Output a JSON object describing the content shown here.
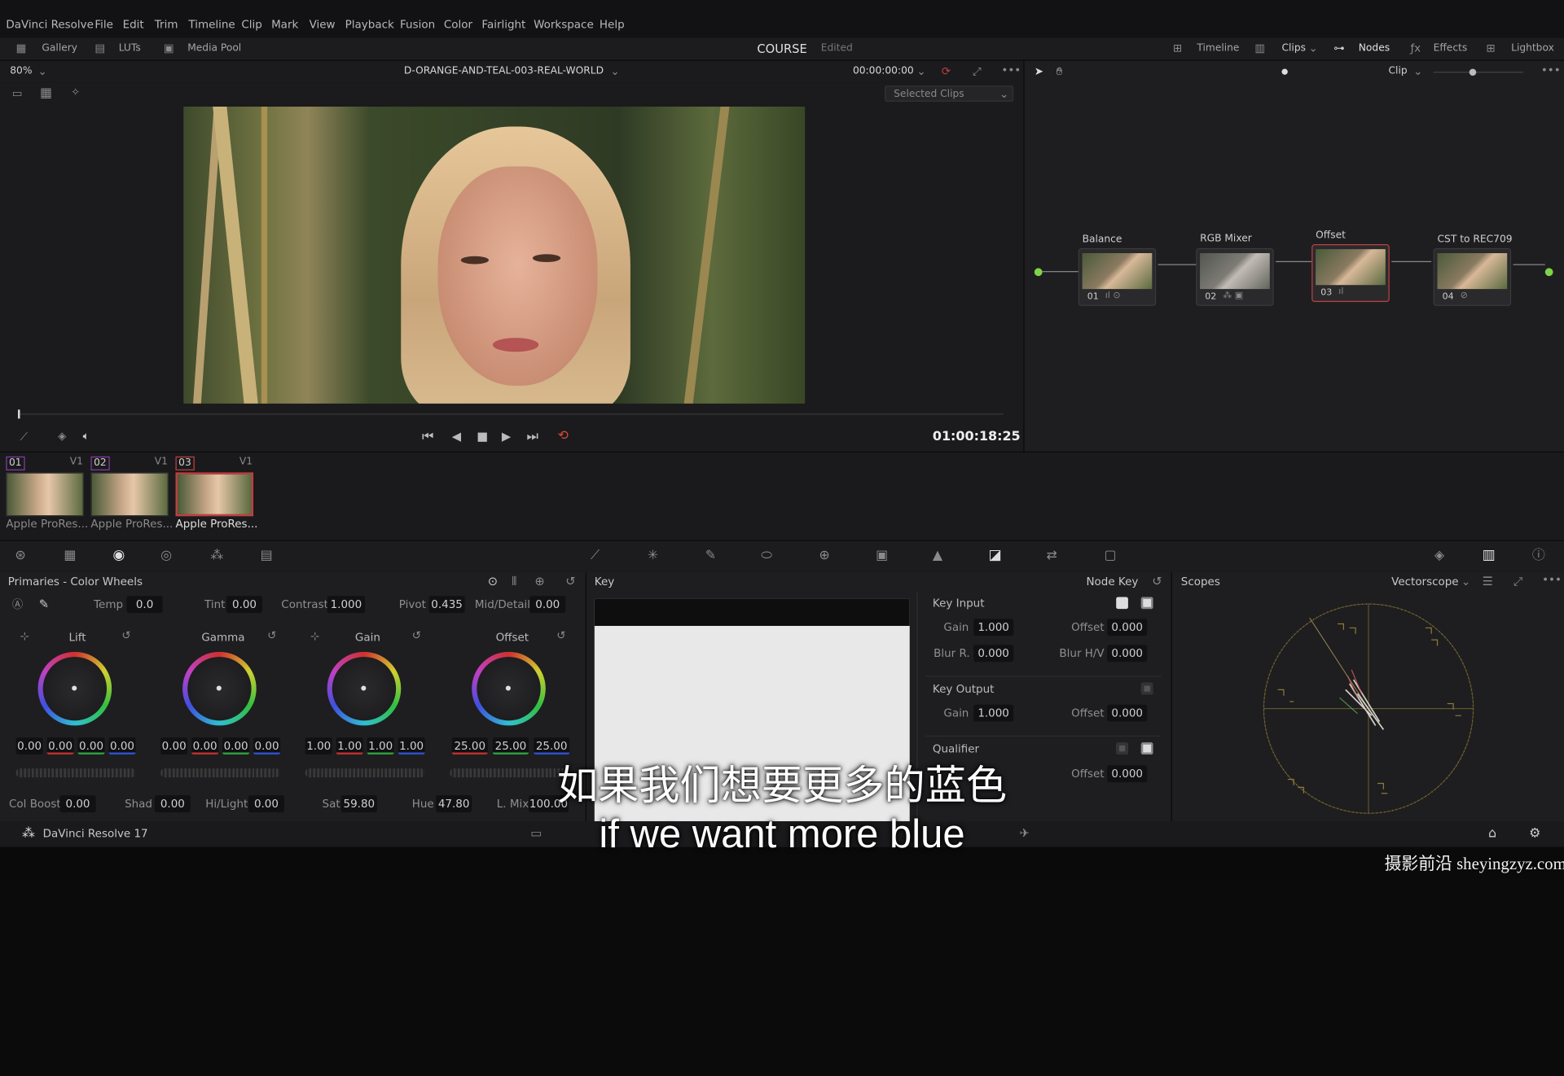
{
  "menu": {
    "app": "DaVinci Resolve",
    "items": [
      "File",
      "Edit",
      "Trim",
      "Timeline",
      "Clip",
      "Mark",
      "View",
      "Playback",
      "Fusion",
      "Color",
      "Fairlight",
      "Workspace",
      "Help"
    ]
  },
  "topbar": {
    "gallery": "Gallery",
    "luts": "LUTs",
    "media_pool": "Media Pool",
    "project": "COURSE",
    "status": "Edited",
    "timeline": "Timeline",
    "clips": "Clips",
    "nodes": "Nodes",
    "effects": "Effects",
    "lightbox": "Lightbox"
  },
  "viewer": {
    "zoom": "80%",
    "clip_name": "D-ORANGE-AND-TEAL-003-REAL-WORLD",
    "timecode": "00:00:00:00",
    "selected": "Selected Clips",
    "playhead_tc": "01:00:18:25"
  },
  "node_graph": {
    "mode": "Clip",
    "nodes": [
      {
        "title": "Balance",
        "num": "01"
      },
      {
        "title": "RGB Mixer",
        "num": "02"
      },
      {
        "title": "Offset",
        "num": "03"
      },
      {
        "title": "CST to REC709",
        "num": "04"
      }
    ]
  },
  "clips": [
    {
      "num": "01",
      "track": "V1",
      "name": "Apple ProRes..."
    },
    {
      "num": "02",
      "track": "V1",
      "name": "Apple ProRes..."
    },
    {
      "num": "03",
      "track": "V1",
      "name": "Apple ProRes..."
    }
  ],
  "primaries": {
    "title": "Primaries - Color Wheels",
    "temp_label": "Temp",
    "temp": "0.0",
    "tint_label": "Tint",
    "tint": "0.00",
    "contrast_label": "Contrast",
    "contrast": "1.000",
    "pivot_label": "Pivot",
    "pivot": "0.435",
    "middetail_label": "Mid/Detail",
    "middetail": "0.00",
    "wheels": [
      {
        "name": "Lift",
        "vals": [
          "0.00",
          "0.00",
          "0.00",
          "0.00"
        ]
      },
      {
        "name": "Gamma",
        "vals": [
          "0.00",
          "0.00",
          "0.00",
          "0.00"
        ]
      },
      {
        "name": "Gain",
        "vals": [
          "1.00",
          "1.00",
          "1.00",
          "1.00"
        ]
      },
      {
        "name": "Offset",
        "vals": [
          "25.00",
          "25.00",
          "25.00"
        ]
      }
    ],
    "colboost_label": "Col Boost",
    "colboost": "0.00",
    "shad_label": "Shad",
    "shad": "0.00",
    "hilight_label": "Hi/Light",
    "hilight": "0.00",
    "sat_label": "Sat",
    "sat": "59.80",
    "hue_label": "Hue",
    "hue": "47.80",
    "lmix_label": "L. Mix",
    "lmix": "100.00"
  },
  "key": {
    "title": "Key",
    "node_key": "Node Key",
    "key_input": "Key Input",
    "gain_label": "Gain",
    "gain": "1.000",
    "offset_label": "Offset",
    "offset": "0.000",
    "blurr_label": "Blur R.",
    "blurr": "0.000",
    "blurhv_label": "Blur H/V",
    "blurhv": "0.000",
    "key_output": "Key Output",
    "out_gain": "1.000",
    "out_offset": "0.000",
    "qualifier": "Qualifier",
    "q_offset": "0.000"
  },
  "scopes": {
    "title": "Scopes",
    "mode": "Vectorscope"
  },
  "status": {
    "app_version": "DaVinci Resolve 17"
  },
  "subtitles": {
    "zh": "如果我们想要更多的蓝色",
    "en": "if we want more blue"
  },
  "watermark": "摄影前沿 sheyingzyz.com"
}
